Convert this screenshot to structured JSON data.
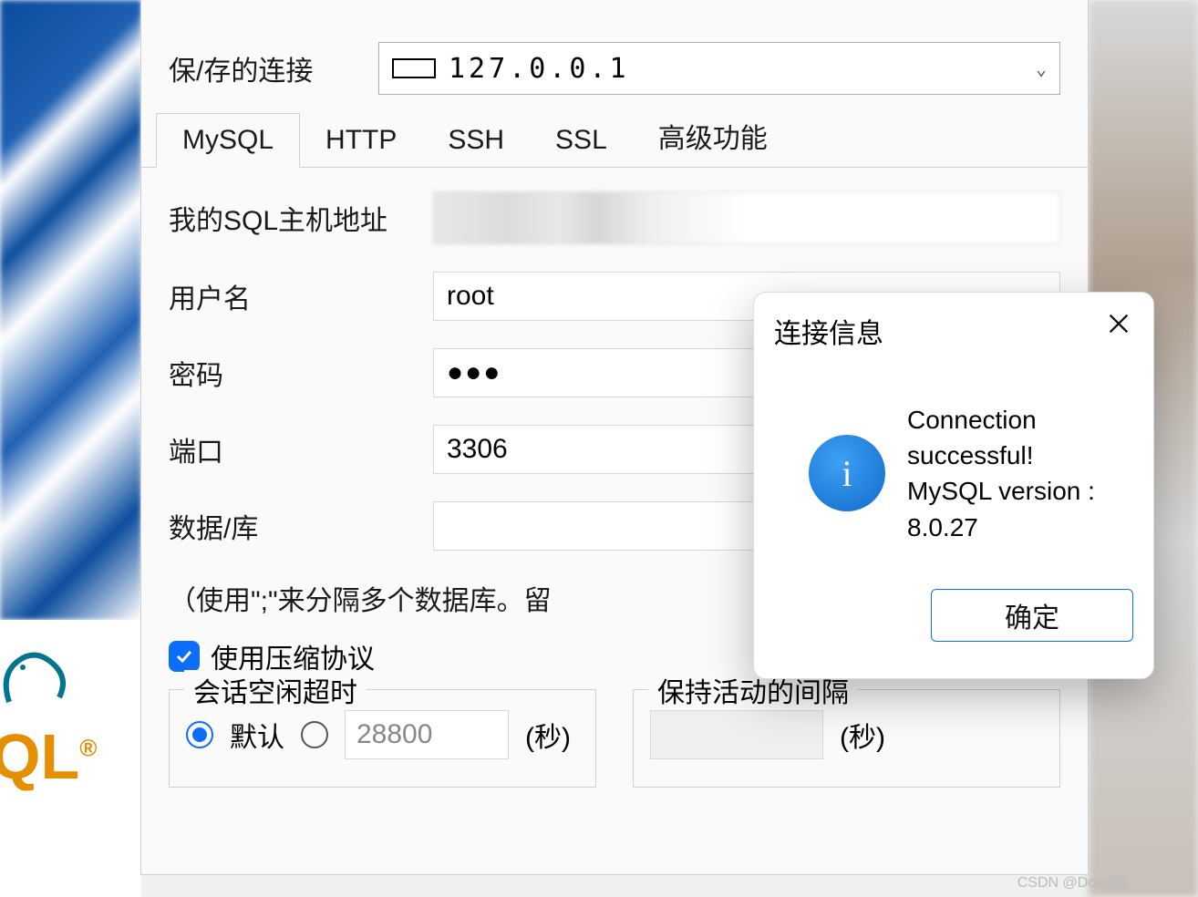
{
  "saved_connection": {
    "label": "保/存的连接",
    "value": "127.0.0.1"
  },
  "tabs": {
    "t0": "MySQL",
    "t1": "HTTP",
    "t2": "SSH",
    "t3": "SSL",
    "t4": "高级功能"
  },
  "form": {
    "host_label": "我的SQL主机地址",
    "user_label": "用户名",
    "user_value": "root",
    "pass_label": "密码",
    "pass_value": "●●●",
    "port_label": "端口",
    "port_value": "3306",
    "db_label": "数据/库",
    "db_value": "",
    "hint": "（使用\";\"来分隔多个数据库。留"
  },
  "compress": {
    "label": "使用压缩协议",
    "checked": true
  },
  "timeout_group": {
    "legend": "会话空闲超时",
    "default_label": "默认",
    "value": "28800",
    "unit": "(秒)"
  },
  "keepalive_group": {
    "legend": "保持活动的间隔",
    "value": "",
    "unit": "(秒)"
  },
  "dialog": {
    "title": "连接信息",
    "line1": "Connection successful!",
    "line2": "MySQL version : 8.0.27",
    "ok": "确定"
  },
  "watermark": "CSDN @Dong雨"
}
